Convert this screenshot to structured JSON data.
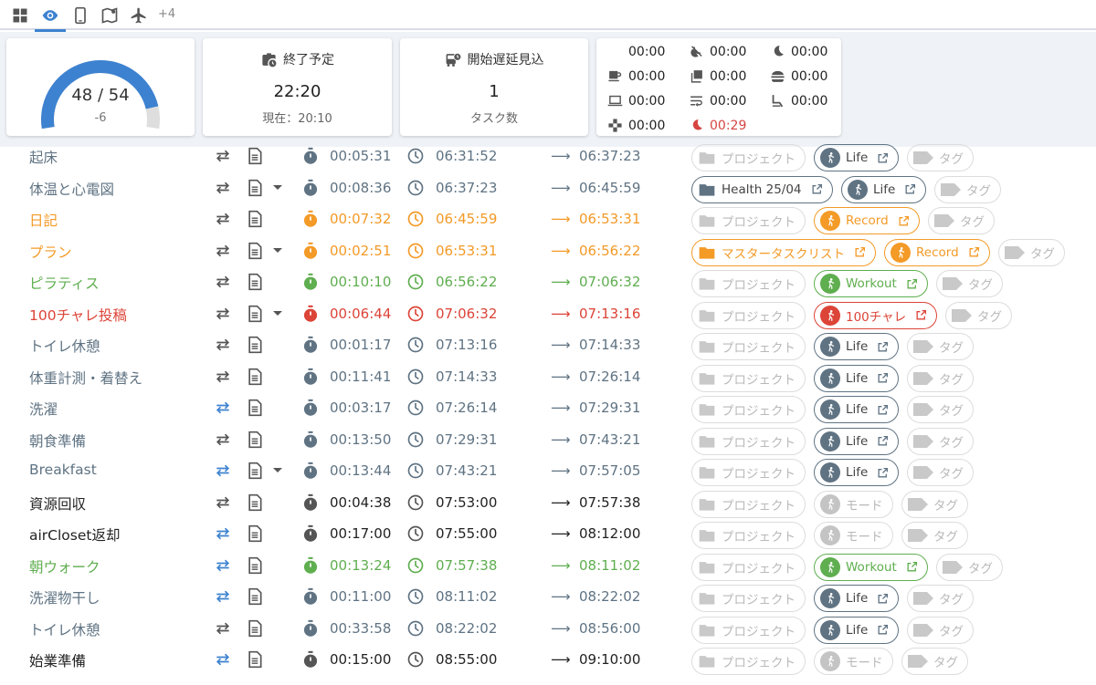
{
  "tabs": [
    {
      "icon": "grid-icon",
      "active": false
    },
    {
      "icon": "eye-icon",
      "active": true
    },
    {
      "icon": "phone-icon",
      "active": false
    },
    {
      "icon": "map-icon",
      "active": false
    },
    {
      "icon": "airplane-icon",
      "active": false
    }
  ],
  "tabs_more": "+4",
  "gauge": {
    "value_label": "48 / 54",
    "sub": "-6",
    "value": 48,
    "max": 54
  },
  "end_card": {
    "title": "終了予定",
    "time": "22:20",
    "now": "現在：20:10"
  },
  "delay_card": {
    "title": "開始遅延見込",
    "count": "1",
    "label": "タスク数"
  },
  "stats": [
    {
      "icon": "clock-blank-icon",
      "value": "00:00"
    },
    {
      "icon": "sleep-off-icon",
      "value": "00:00"
    },
    {
      "icon": "moon-icon",
      "value": "00:00"
    },
    {
      "icon": "coffee-icon",
      "value": "00:00"
    },
    {
      "icon": "library-icon",
      "value": "00:00"
    },
    {
      "icon": "burger-icon",
      "value": "00:00"
    },
    {
      "icon": "laptop-icon",
      "value": "00:00"
    },
    {
      "icon": "wrap-icon",
      "value": "00:00"
    },
    {
      "icon": "seat-recline-icon",
      "value": "00:00"
    },
    {
      "icon": "gamepad-icon",
      "value": "00:00"
    },
    {
      "icon": "moon-red-icon",
      "value": "00:29",
      "color": "#d64541"
    }
  ],
  "colors": {
    "gray": "#5f7383",
    "orange": "#f39a27",
    "green": "#5fae4f",
    "red": "#dc4438",
    "black": "#222222",
    "blue_repeat": "#3d82d0"
  },
  "placeholders": {
    "project": "プロジェクト",
    "tag": "タグ",
    "mode": "モード"
  },
  "tasks": [
    {
      "name": "起床",
      "color": "gray",
      "repeat_blue": false,
      "dropdown": false,
      "duration": "00:05:31",
      "start": "06:31:52",
      "end": "06:37:23",
      "project": null,
      "mode": "Life"
    },
    {
      "name": "体温と心電図",
      "color": "gray",
      "repeat_blue": false,
      "dropdown": true,
      "duration": "00:08:36",
      "start": "06:37:23",
      "end": "06:45:59",
      "project": "Health 25/04",
      "mode": "Life"
    },
    {
      "name": "日記",
      "color": "orange",
      "repeat_blue": false,
      "dropdown": false,
      "duration": "00:07:32",
      "start": "06:45:59",
      "end": "06:53:31",
      "project": null,
      "mode": "Record"
    },
    {
      "name": "プラン",
      "color": "orange",
      "repeat_blue": false,
      "dropdown": true,
      "duration": "00:02:51",
      "start": "06:53:31",
      "end": "06:56:22",
      "project": "マスタータスクリスト",
      "mode": "Record"
    },
    {
      "name": "ピラティス",
      "color": "green",
      "repeat_blue": false,
      "dropdown": false,
      "duration": "00:10:10",
      "start": "06:56:22",
      "end": "07:06:32",
      "project": null,
      "mode": "Workout"
    },
    {
      "name": "100チャレ投稿",
      "color": "red",
      "repeat_blue": false,
      "dropdown": true,
      "duration": "00:06:44",
      "start": "07:06:32",
      "end": "07:13:16",
      "project": null,
      "mode": "100チャレ"
    },
    {
      "name": "トイレ休憩",
      "color": "gray",
      "repeat_blue": false,
      "dropdown": false,
      "duration": "00:01:17",
      "start": "07:13:16",
      "end": "07:14:33",
      "project": null,
      "mode": "Life"
    },
    {
      "name": "体重計測・着替え",
      "color": "gray",
      "repeat_blue": false,
      "dropdown": false,
      "duration": "00:11:41",
      "start": "07:14:33",
      "end": "07:26:14",
      "project": null,
      "mode": "Life"
    },
    {
      "name": "洗濯",
      "color": "gray",
      "repeat_blue": true,
      "dropdown": false,
      "duration": "00:03:17",
      "start": "07:26:14",
      "end": "07:29:31",
      "project": null,
      "mode": "Life"
    },
    {
      "name": "朝食準備",
      "color": "gray",
      "repeat_blue": false,
      "dropdown": false,
      "duration": "00:13:50",
      "start": "07:29:31",
      "end": "07:43:21",
      "project": null,
      "mode": "Life"
    },
    {
      "name": "Breakfast",
      "color": "gray",
      "repeat_blue": true,
      "dropdown": true,
      "duration": "00:13:44",
      "start": "07:43:21",
      "end": "07:57:05",
      "project": null,
      "mode": "Life"
    },
    {
      "name": "資源回収",
      "color": "black",
      "repeat_blue": false,
      "dropdown": false,
      "duration": "00:04:38",
      "start": "07:53:00",
      "end": "07:57:38",
      "project": null,
      "mode": null
    },
    {
      "name": "airCloset返却",
      "color": "black",
      "repeat_blue": true,
      "dropdown": false,
      "duration": "00:17:00",
      "start": "07:55:00",
      "end": "08:12:00",
      "project": null,
      "mode": null
    },
    {
      "name": "朝ウォーク",
      "color": "green",
      "repeat_blue": true,
      "dropdown": false,
      "duration": "00:13:24",
      "start": "07:57:38",
      "end": "08:11:02",
      "project": null,
      "mode": "Workout"
    },
    {
      "name": "洗濯物干し",
      "color": "gray",
      "repeat_blue": true,
      "dropdown": false,
      "duration": "00:11:00",
      "start": "08:11:02",
      "end": "08:22:02",
      "project": null,
      "mode": "Life"
    },
    {
      "name": "トイレ休憩",
      "color": "gray",
      "repeat_blue": false,
      "dropdown": false,
      "duration": "00:33:58",
      "start": "08:22:02",
      "end": "08:56:00",
      "project": null,
      "mode": "Life"
    },
    {
      "name": "始業準備",
      "color": "black",
      "repeat_blue": true,
      "dropdown": false,
      "duration": "00:15:00",
      "start": "08:55:00",
      "end": "09:10:00",
      "project": null,
      "mode": null
    }
  ]
}
